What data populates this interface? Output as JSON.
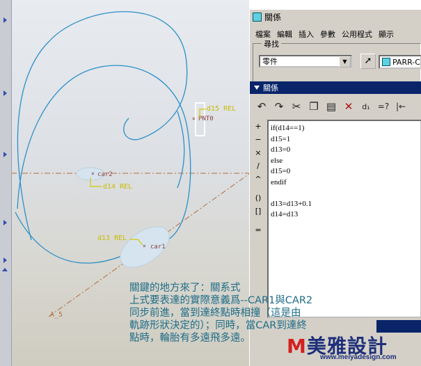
{
  "window": {
    "title": "關係",
    "menu": [
      "檔案",
      "編輯",
      "插入",
      "參數",
      "公用程式",
      "顯示"
    ]
  },
  "search": {
    "legend": "尋找",
    "type_value": "零件",
    "model_value": "PARR-C"
  },
  "relations_bar": {
    "label": "關係"
  },
  "operators": [
    "+",
    "−",
    "×",
    "/",
    "^",
    "()",
    "[]",
    "="
  ],
  "relations": [
    "if(d14==1)",
    "d15=1",
    "d13=0",
    "else",
    "d15=0",
    "endif",
    "",
    "d13=d13+0.1",
    "d14=d13"
  ],
  "cad": {
    "labels": {
      "d15": "d15 REL",
      "pnt0": "PNT0",
      "car2": "car2",
      "d14": "d14 REL",
      "d13": "d13 REL",
      "car1": "car1",
      "axis": "A_5"
    },
    "colors": {
      "curve": "#2a90c8",
      "dimension": "#d4c800",
      "axis": "#b07040"
    }
  },
  "caption": {
    "lines": [
      "關鍵的地方來了：關系式",
      "上式要表達的實際意義爲--CAR1與CAR2",
      "同步前進，當到達終點時相撞（這是由",
      "軌跡形狀決定的）；同時，當CAR到達終",
      "點時，輪胎有多遠飛多遠。"
    ]
  },
  "watermark": {
    "logo": "美雅設計",
    "url": "www.meiyadesign.com"
  }
}
